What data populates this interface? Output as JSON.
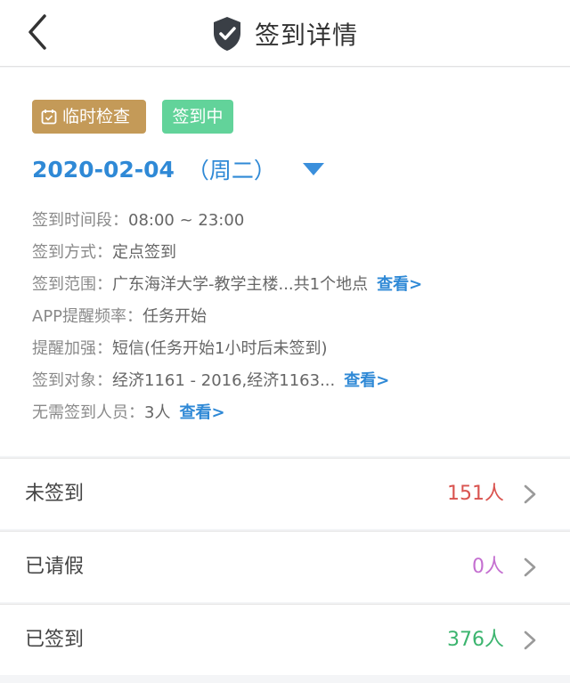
{
  "header": {
    "title": "签到详情",
    "back_icon": "chevron-left-icon",
    "title_icon": "shield-check-icon"
  },
  "card": {
    "tag_type": "临时检查",
    "tag_status": "签到中",
    "date": "2020-02-04",
    "weekday": "（周二）",
    "info": {
      "time_label": "签到时间段：",
      "time_value": "08:00 ~ 23:00",
      "method_label": "签到方式：",
      "method_value": "定点签到",
      "range_label": "签到范围：",
      "range_value": "广东海洋大学-教学主楼...共1个地点",
      "range_link": "查看>",
      "reminder_label": "APP提醒频率：",
      "reminder_value": "任务开始",
      "enhance_label": "提醒加强：",
      "enhance_value": "短信(任务开始1小时后未签到)",
      "target_label": "签到对象：",
      "target_value": "经济1161 - 2016,经济1163...",
      "target_link": "查看>",
      "exempt_label": "无需签到人员：",
      "exempt_value": "3人",
      "exempt_link": "查看>"
    }
  },
  "stats": [
    {
      "label": "未签到",
      "count": "151人",
      "color": "#d9534f"
    },
    {
      "label": "已请假",
      "count": "0人",
      "color": "#c46fd0"
    },
    {
      "label": "已签到",
      "count": "376人",
      "color": "#3bb46e"
    }
  ],
  "colors": {
    "accent": "#2f89d6",
    "tag_temp": "#c49a58",
    "tag_status": "#62d39a"
  }
}
